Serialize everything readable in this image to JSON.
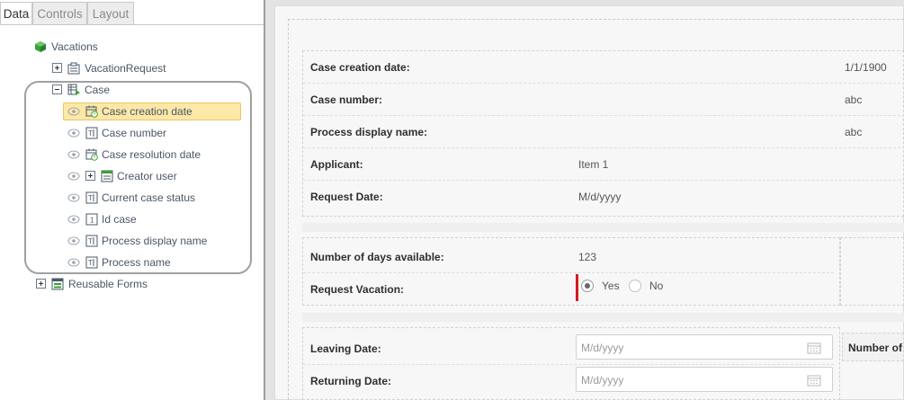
{
  "tabs": [
    {
      "label": "Data",
      "active": true
    },
    {
      "label": "Controls",
      "active": false
    },
    {
      "label": "Layout",
      "active": false
    }
  ],
  "tree": {
    "root": "Vacations",
    "vacation_request": "VacationRequest",
    "case": "Case",
    "case_children": [
      "Case creation date",
      "Case number",
      "Case resolution date",
      "Creator user",
      "Current case status",
      "Id case",
      "Process display name",
      "Process name"
    ],
    "reusable_forms": "Reusable Forms",
    "selected_item": "Case creation date"
  },
  "form": {
    "case_creation_date": {
      "label": "Case creation date:",
      "value": "1/1/1900"
    },
    "case_number": {
      "label": "Case number:",
      "value": "abc"
    },
    "process_display_name": {
      "label": "Process display name:",
      "value": "abc"
    },
    "applicant": {
      "label": "Applicant:",
      "value": "Item 1"
    },
    "request_date": {
      "label": "Request Date:",
      "value": "M/d/yyyy"
    },
    "days_available": {
      "label": "Number of days available:",
      "value": "123"
    },
    "request_vacation": {
      "label": "Request Vacation:",
      "options": [
        "Yes",
        "No"
      ],
      "selected": "Yes"
    },
    "leaving_date": {
      "label": "Leaving Date:",
      "placeholder": "M/d/yyyy"
    },
    "returning_date": {
      "label": "Returning Date:",
      "placeholder": "M/d/yyyy"
    },
    "number_of_partial": "Number of"
  },
  "colors": {
    "selection_fill": "#fde8a8",
    "required_marker": "#d81b1b",
    "icon_green": "#3aa03a"
  },
  "icons": {
    "root": "green-cube-icon",
    "entity": "entity-form-icon",
    "collection": "table-collection-icon",
    "date": "calendar-clock-icon",
    "text": "text-attribute-icon",
    "number": "number-attribute-icon",
    "user": "user-table-icon",
    "forms": "forms-icon",
    "visibility": "eye-icon",
    "calendar": "calendar-icon"
  }
}
